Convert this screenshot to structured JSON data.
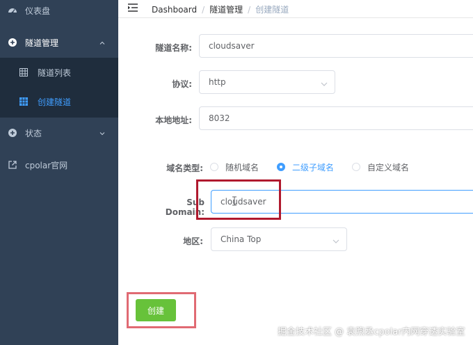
{
  "sidebar": {
    "items": [
      {
        "label": "仪表盘",
        "icon": "dashboard-icon"
      },
      {
        "label": "隧道管理",
        "icon": "plus-circle-icon"
      },
      {
        "label": "状态",
        "icon": "plus-circle-icon"
      },
      {
        "label": "cpolar官网",
        "icon": "external-link-icon"
      }
    ],
    "submenu": [
      {
        "label": "隧道列表",
        "icon": "table-icon"
      },
      {
        "label": "创建隧道",
        "icon": "table-icon",
        "active": true
      }
    ]
  },
  "header": {
    "breadcrumb": [
      "Dashboard",
      "隧道管理",
      "创建隧道"
    ]
  },
  "form": {
    "tunnel_name": {
      "label": "隧道名称:",
      "value": "cloudsaver"
    },
    "protocol": {
      "label": "协议:",
      "value": "http"
    },
    "local_address": {
      "label": "本地地址:",
      "value": "8032"
    },
    "domain_type": {
      "label": "域名类型:",
      "options": [
        "随机域名",
        "二级子域名",
        "自定义域名"
      ],
      "selected": "二级子域名"
    },
    "sub_domain": {
      "label": "Sub Domain:",
      "value": "cloudsaver"
    },
    "region": {
      "label": "地区:",
      "value": "China Top"
    },
    "submit_label": "创建"
  },
  "watermark": "掘金技术社区 @ 袁煦丞cpolar内网穿透实验室",
  "colors": {
    "sidebar_bg": "#304156",
    "submenu_bg": "#1f2d3d",
    "accent": "#409eff",
    "success": "#67c23a",
    "highlight": "#b0192e"
  }
}
